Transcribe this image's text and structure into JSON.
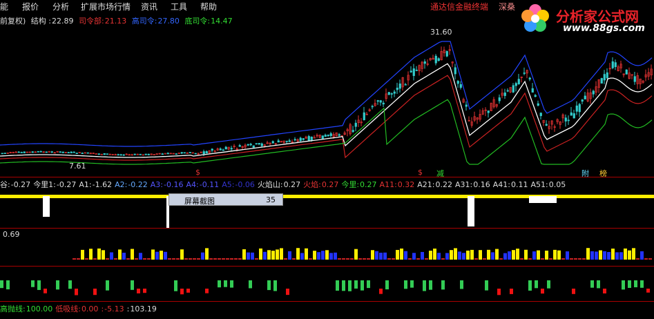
{
  "menu": {
    "items": [
      "能",
      "报价",
      "分析",
      "扩展市场行情",
      "资讯",
      "工具",
      "帮助"
    ],
    "brand": "通达信金融终端",
    "extra": "深桑"
  },
  "logo": {
    "title": "分析家公式网",
    "site": "www.88gs.com"
  },
  "main_panel": {
    "prefix": "前复权)",
    "structure": {
      "label": "结构 :",
      "value": "22.89"
    },
    "line1": {
      "label": "司令部:",
      "value": "21.13",
      "color": "#e53333"
    },
    "line2": {
      "label": "高司令:",
      "value": "27.80",
      "color": "#3366ff"
    },
    "line3": {
      "label": "底司令:",
      "value": "14.47",
      "color": "#33cc33"
    },
    "high_mark": "31.60",
    "low_mark": "7.61",
    "signals": [
      "$",
      "$",
      "减",
      "附",
      "榜"
    ]
  },
  "indicator_row": {
    "items": [
      {
        "label": "谷:",
        "value": "-0.27",
        "color": "#dddddd"
      },
      {
        "label": "今里1:",
        "value": "-0.27",
        "color": "#dddddd"
      },
      {
        "label": "A1:",
        "value": "-1.62",
        "color": "#dddddd"
      },
      {
        "label": "A2:",
        "value": "-0.22",
        "color": "#66aaff"
      },
      {
        "label": "A3:",
        "value": "-0.16",
        "color": "#5555ff"
      },
      {
        "label": "A4:",
        "value": "-0.11",
        "color": "#5555ff"
      },
      {
        "label": "A5:",
        "value": "-0.06",
        "color": "#3333cc"
      },
      {
        "label": "火焰山:",
        "value": "0.27",
        "color": "#dddddd"
      },
      {
        "label": "火焰:",
        "value": "0.27",
        "color": "#e53333"
      },
      {
        "label": "今里:",
        "value": "0.27",
        "color": "#33dd33"
      },
      {
        "label": "A11:",
        "value": "0.32",
        "color": "#e53333"
      },
      {
        "label": "A21:",
        "value": "0.22",
        "color": "#dddddd"
      },
      {
        "label": "A31:",
        "value": "0.16",
        "color": "#dddddd"
      },
      {
        "label": "A41:",
        "value": "0.11",
        "color": "#dddddd"
      },
      {
        "label": "A51:",
        "value": "0.05",
        "color": "#dddddd"
      }
    ]
  },
  "popup": {
    "label": "屏幕截图",
    "value": "35"
  },
  "panel3": {
    "value": "0.69"
  },
  "bottom_row": {
    "items": [
      {
        "label": "高抛线:",
        "value": "100.00",
        "color": "#33dd33"
      },
      {
        "label": "低吸线:",
        "value": "0.00",
        "color": "#e53333"
      },
      {
        "label": ":",
        "value": "-5.13",
        "color": "#e53333"
      },
      {
        "label": ":",
        "value": "103.19",
        "color": "#dddddd"
      }
    ]
  },
  "colors": {
    "up": "#e53333",
    "down": "#33cccc",
    "bg": "#000000",
    "separator": "#aa0000"
  }
}
